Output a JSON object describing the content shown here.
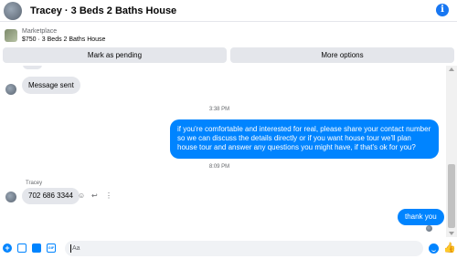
{
  "header": {
    "title": "Tracey · 3 Beds 2 Baths House"
  },
  "listing": {
    "label": "Marketplace",
    "detail": "$750 · 3 Beds 2 Baths House"
  },
  "actions": {
    "pending_label": "Mark as pending",
    "more_label": "More options"
  },
  "messages": {
    "cut_off_text": "...",
    "message_sent": "Message sent",
    "timestamp_1": "3:38 PM",
    "outgoing_long": "if you're comfortable and interested for real, please share your contact number so we can discuss the details directly or if you want house tour we'll plan house tour and answer any questions you might have, if that's ok for you?",
    "timestamp_2": "8:09 PM",
    "sender": "Tracey",
    "phone": "702 686 3344",
    "outgoing_short": "thank you"
  },
  "composer": {
    "placeholder": "Aa"
  },
  "icons": {
    "info": "info-icon",
    "plus": "plus-circle-icon",
    "image": "image-icon",
    "sticker": "sticker-icon",
    "gif": "gif-icon",
    "emoji": "emoji-icon",
    "like": "thumbs-up-icon",
    "react": "smiley-icon",
    "reply": "reply-icon",
    "more": "more-dots-icon"
  },
  "colors": {
    "accent": "#0084ff",
    "bubble_in": "#e4e6eb",
    "button_bg": "#e4e6eb"
  }
}
